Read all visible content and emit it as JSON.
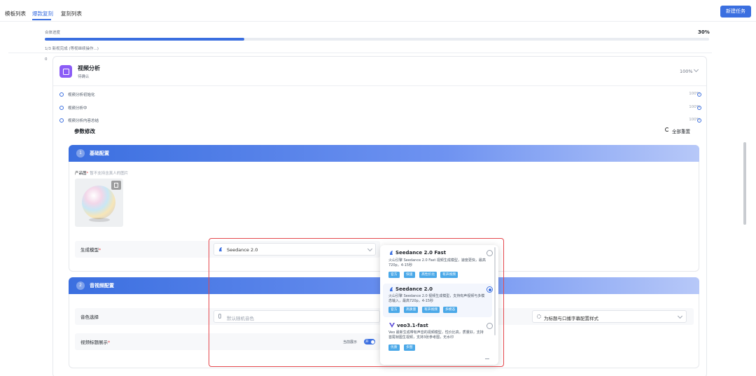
{
  "tabs": [
    {
      "label": "模板列表"
    },
    {
      "label": "爆款复刻"
    },
    {
      "label": "复刻列表"
    }
  ],
  "header": {
    "new_task": "新建任务"
  },
  "progress": {
    "label": "合体进度",
    "percent_text": "30%",
    "value": 0.3,
    "status": "1/3 新视完成 (等视继续操作...)"
  },
  "stage_index": "0",
  "video_analysis": {
    "title": "视频分析",
    "subtitle": "待确认",
    "percent": "100%",
    "steps": [
      {
        "label": "视频分析初始化",
        "percent": "100%"
      },
      {
        "label": "视频分析中",
        "percent": "100%"
      },
      {
        "label": "视频分析内容总结",
        "percent": "100%"
      }
    ]
  },
  "params": {
    "title": "参数修改",
    "reset_all": "全部重置"
  },
  "basic": {
    "num": "1",
    "title": "基础配置",
    "product_label": "产品图",
    "product_hint": "暂不支持含真人的图片",
    "model_label": "生成模型",
    "model_value": "Seedance 2.0"
  },
  "av": {
    "num": "2",
    "title": "音视频配置",
    "voice_label": "音色选择",
    "voice_placeholder": "默认随机音色",
    "subtitle_style": "为标题与口播字幕配置样式",
    "title_display_label": "视频标题展示",
    "current_display": "当前展示",
    "toggle_text": "开"
  },
  "model_options": [
    {
      "name": "Seedance 2.0 Fast",
      "desc": "火山引擎 Seedance 2.0 Fast 视频生成模型，速度更快，最高720p，4-15秒",
      "tags": [
        "官方",
        "快速",
        "高性价比",
        "有声视频"
      ],
      "selected": false
    },
    {
      "name": "Seedance 2.0",
      "desc": "火山引擎 Seedance 2.0 视频生成模型，支持有声视频与多模态输入，最高720p，4-15秒",
      "tags": [
        "官方",
        "高质量",
        "有声视频",
        "多模态"
      ],
      "selected": true
    },
    {
      "name": "veo3.1-fast",
      "desc": "Veo 最新生成带有声音的视频模型，性价比高，质量好，支持首尾帧图生视频，支持3张参考图，无水印",
      "tags": [
        "优质",
        "多图"
      ],
      "selected": false
    }
  ],
  "colors": {
    "accent": "#3b6fe0",
    "highlight": "#e5484d",
    "tag": "#4aa8e8",
    "section_icon": "#8b5cf6"
  }
}
